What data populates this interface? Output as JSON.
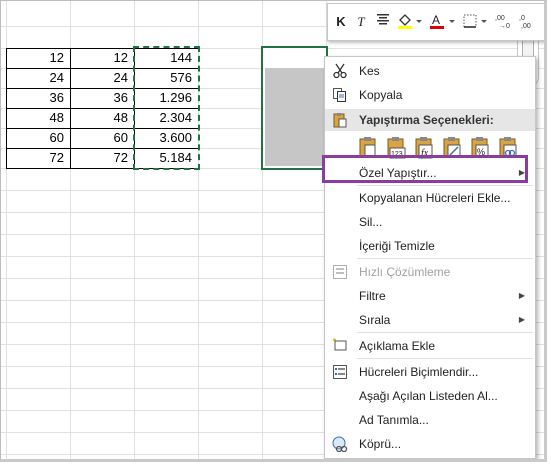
{
  "sheet": {
    "rows": [
      [
        "12",
        "12",
        "144"
      ],
      [
        "24",
        "24",
        "576"
      ],
      [
        "36",
        "36",
        "1.296"
      ],
      [
        "48",
        "48",
        "2.304"
      ],
      [
        "60",
        "60",
        "3.600"
      ],
      [
        "72",
        "72",
        "5.184"
      ]
    ]
  },
  "mini_toolbar": {
    "bold": "K",
    "italic": "T"
  },
  "menu": {
    "cut": "Kes",
    "copy": "Kopyala",
    "paste_options_header": "Yapıştırma Seçenekleri:",
    "paste_special": "Özel Yapıştır...",
    "insert_copied": "Kopyalanan Hücreleri Ekle...",
    "delete": "Sil...",
    "clear_contents": "İçeriği Temizle",
    "quick_analysis": "Hızlı Çözümleme",
    "filter": "Filtre",
    "sort": "Sırala",
    "insert_comment": "Açıklama Ekle",
    "format_cells": "Hücreleri Biçimlendir...",
    "pick_from_list": "Aşağı Açılan Listeden Al...",
    "define_name": "Ad Tanımla...",
    "hyperlink": "Köprü..."
  },
  "colors": {
    "selection": "#217346",
    "highlight": "#8a3d9f",
    "fill_yellow": "#ffff00",
    "font_red": "#e00000"
  }
}
